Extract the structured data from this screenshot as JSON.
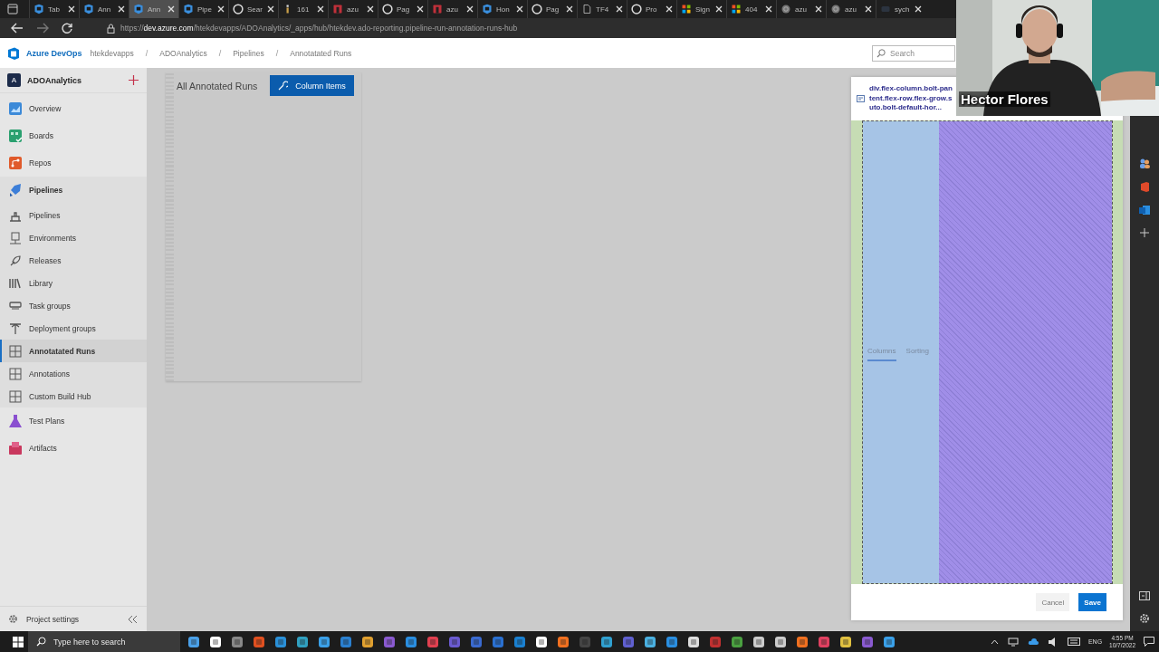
{
  "browser": {
    "tabs": [
      {
        "title": "Tab",
        "kind": "devops",
        "selected": false
      },
      {
        "title": "Ann",
        "kind": "devops",
        "selected": false
      },
      {
        "title": "Ann",
        "kind": "devops",
        "selected": true
      },
      {
        "title": "Pipe",
        "kind": "devops",
        "selected": false
      },
      {
        "title": "Sear",
        "kind": "github",
        "selected": false
      },
      {
        "title": "161",
        "kind": "info",
        "selected": false
      },
      {
        "title": "azu",
        "kind": "red",
        "selected": false
      },
      {
        "title": "Pag",
        "kind": "github",
        "selected": false
      },
      {
        "title": "azu",
        "kind": "red",
        "selected": false
      },
      {
        "title": "Hon",
        "kind": "devops",
        "selected": false
      },
      {
        "title": "Pag",
        "kind": "github",
        "selected": false
      },
      {
        "title": "TF4",
        "kind": "page",
        "selected": false
      },
      {
        "title": "Pro",
        "kind": "github",
        "selected": false
      },
      {
        "title": "Sign",
        "kind": "ms",
        "selected": false
      },
      {
        "title": "404",
        "kind": "ms",
        "selected": false
      },
      {
        "title": "azu",
        "kind": "globe",
        "selected": false
      },
      {
        "title": "azu",
        "kind": "globe",
        "selected": false
      },
      {
        "title": "sych",
        "kind": "blank",
        "selected": false
      }
    ],
    "url": "https://**dev.azure.com**/htekdevapps/ADOAnalytics/_apps/hub/htekdev.ado-reporting.pipeline-run-annotation-runs-hub"
  },
  "header": {
    "product": "Azure DevOps",
    "breadcrumbs": [
      "htekdevapps",
      "ADOAnalytics",
      "Pipelines",
      "Annotatated Runs"
    ],
    "separators": [
      "/",
      "/",
      "/"
    ],
    "search": {
      "placeholder": "Search"
    }
  },
  "sidebar": {
    "project": {
      "initial": "A",
      "name": "ADOAnalytics"
    },
    "items": [
      {
        "label": "Overview",
        "kind": "overview",
        "selected": false
      },
      {
        "label": "Boards",
        "kind": "boards",
        "selected": false
      },
      {
        "label": "Repos",
        "kind": "repos",
        "selected": false
      },
      {
        "label": "Pipelines",
        "kind": "pipelines",
        "selected": false,
        "children": [
          {
            "label": "Pipelines",
            "kind": "builds",
            "selected": false
          },
          {
            "label": "Environments",
            "kind": "environments",
            "selected": false
          },
          {
            "label": "Releases",
            "kind": "releases",
            "selected": false
          },
          {
            "label": "Library",
            "kind": "library",
            "selected": false
          },
          {
            "label": "Task groups",
            "kind": "taskgroups",
            "selected": false
          },
          {
            "label": "Deployment groups",
            "kind": "deployment",
            "selected": false
          },
          {
            "label": "Annotatated Runs",
            "kind": "hub",
            "selected": true
          },
          {
            "label": "Annotations",
            "kind": "hub",
            "selected": false
          },
          {
            "label": "Custom Build Hub",
            "kind": "hub",
            "selected": false
          }
        ]
      },
      {
        "label": "Test Plans",
        "kind": "testplans",
        "selected": false
      },
      {
        "label": "Artifacts",
        "kind": "artifacts",
        "selected": false
      }
    ],
    "footer": {
      "label": "Project settings"
    }
  },
  "content": {
    "title": "All Annotated Runs",
    "button": "Column Items"
  },
  "panel": {
    "tooltip": [
      "div.flex-column.bolt-pan",
      "tent.flex-row.flex-grow.s",
      "uto.bolt-default-hor..."
    ],
    "tabs": [
      {
        "label": "Columns",
        "selected": true
      },
      {
        "label": "Sorting",
        "selected": false
      }
    ],
    "buttons": [
      {
        "label": "Cancel",
        "kind": "secondary"
      },
      {
        "label": "Save",
        "kind": "primary"
      }
    ]
  },
  "webcam": {
    "name": "Hector Flores"
  },
  "taskbar": {
    "search": {
      "placeholder": "Type here to search"
    },
    "language": "ENG",
    "time": "4:55 PM",
    "date": "10/7/2022"
  }
}
